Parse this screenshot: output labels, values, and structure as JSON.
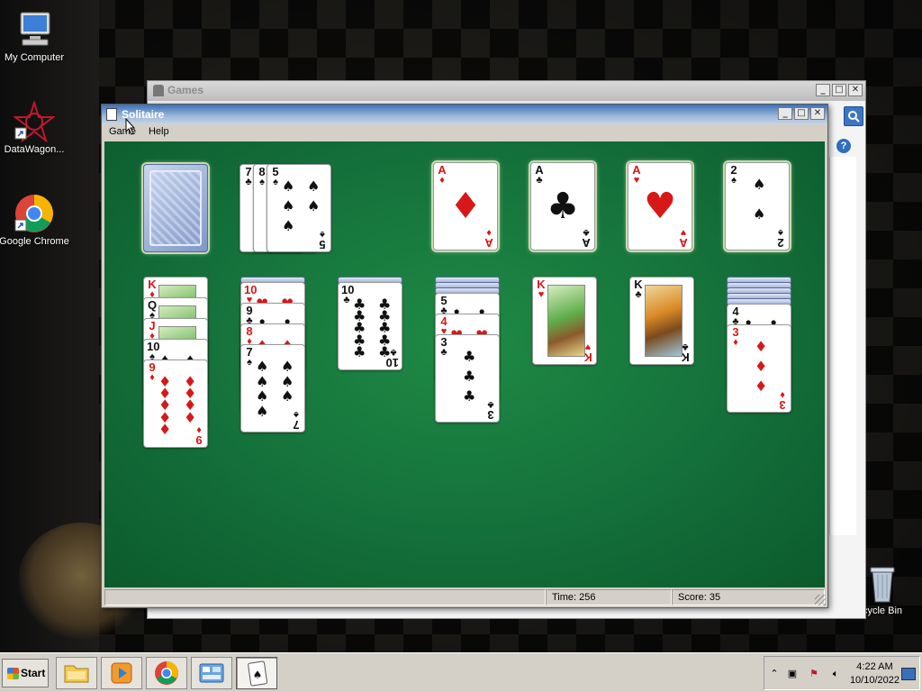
{
  "desktop": {
    "icons": [
      {
        "label": "My Computer"
      },
      {
        "label": "DataWagon..."
      },
      {
        "label": "Google Chrome"
      },
      {
        "label": "cycle Bin"
      }
    ]
  },
  "games_window": {
    "title": "Games",
    "controls": {
      "minimize": "_",
      "maximize": "□",
      "close": "✕"
    },
    "search_icon": "search-icon",
    "help_icon": "?"
  },
  "solitaire_window": {
    "title": "Solitaire",
    "controls": {
      "minimize": "_",
      "maximize": "□",
      "close": "✕"
    },
    "menu": [
      "Game",
      "Help"
    ],
    "status": {
      "time": "Time:  256",
      "score": "Score: 35"
    },
    "stock": {
      "face_down": true
    },
    "waste": [
      {
        "rank": "7",
        "suit": "♣",
        "color": "black"
      },
      {
        "rank": "8",
        "suit": "♠",
        "color": "black"
      },
      {
        "rank": "5",
        "suit": "♠",
        "color": "black"
      }
    ],
    "foundations": [
      {
        "rank": "A",
        "suit": "♦",
        "color": "red"
      },
      {
        "rank": "A",
        "suit": "♣",
        "color": "black"
      },
      {
        "rank": "A",
        "suit": "♥",
        "color": "red"
      },
      {
        "rank": "2",
        "suit": "♠",
        "color": "black"
      }
    ],
    "tableau": [
      {
        "hidden": 0,
        "cards": [
          {
            "rank": "K",
            "suit": "♦",
            "color": "red"
          },
          {
            "rank": "Q",
            "suit": "♠",
            "color": "black"
          },
          {
            "rank": "J",
            "suit": "♦",
            "color": "red"
          },
          {
            "rank": "10",
            "suit": "♠",
            "color": "black"
          },
          {
            "rank": "9",
            "suit": "♦",
            "color": "red"
          }
        ]
      },
      {
        "hidden": 1,
        "cards": [
          {
            "rank": "10",
            "suit": "♥",
            "color": "red"
          },
          {
            "rank": "9",
            "suit": "♣",
            "color": "black"
          },
          {
            "rank": "8",
            "suit": "♦",
            "color": "red"
          },
          {
            "rank": "7",
            "suit": "♠",
            "color": "black"
          }
        ]
      },
      {
        "hidden": 1,
        "cards": [
          {
            "rank": "10",
            "suit": "♣",
            "color": "black"
          }
        ]
      },
      {
        "hidden": 3,
        "cards": [
          {
            "rank": "5",
            "suit": "♣",
            "color": "black"
          },
          {
            "rank": "4",
            "suit": "♥",
            "color": "red"
          },
          {
            "rank": "3",
            "suit": "♣",
            "color": "black"
          }
        ]
      },
      {
        "hidden": 0,
        "cards": [
          {
            "rank": "K",
            "suit": "♥",
            "color": "red"
          }
        ]
      },
      {
        "hidden": 0,
        "cards": [
          {
            "rank": "K",
            "suit": "♣",
            "color": "black"
          }
        ]
      },
      {
        "hidden": 5,
        "cards": [
          {
            "rank": "4",
            "suit": "♣",
            "color": "black"
          },
          {
            "rank": "3",
            "suit": "♦",
            "color": "red"
          }
        ]
      }
    ]
  },
  "taskbar": {
    "start_label": "Start",
    "buttons": [
      "file-explorer",
      "media-player",
      "google-chrome",
      "control-panel",
      "solitaire"
    ],
    "clock_time": "4:22 AM",
    "clock_date": "10/10/2022"
  },
  "colors": {
    "felt": "#14703a",
    "red_suit": "#d81818",
    "titlebar": "#3c6fb6"
  }
}
